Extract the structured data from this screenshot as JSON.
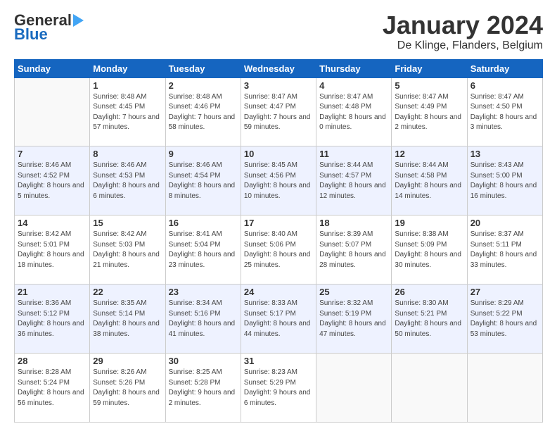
{
  "header": {
    "logo_line1": "General",
    "logo_line2": "Blue",
    "title": "January 2024",
    "subtitle": "De Klinge, Flanders, Belgium"
  },
  "days_of_week": [
    "Sunday",
    "Monday",
    "Tuesday",
    "Wednesday",
    "Thursday",
    "Friday",
    "Saturday"
  ],
  "weeks": [
    [
      {
        "day": "",
        "sunrise": "",
        "sunset": "",
        "daylight": ""
      },
      {
        "day": "1",
        "sunrise": "Sunrise: 8:48 AM",
        "sunset": "Sunset: 4:45 PM",
        "daylight": "Daylight: 7 hours and 57 minutes."
      },
      {
        "day": "2",
        "sunrise": "Sunrise: 8:48 AM",
        "sunset": "Sunset: 4:46 PM",
        "daylight": "Daylight: 7 hours and 58 minutes."
      },
      {
        "day": "3",
        "sunrise": "Sunrise: 8:47 AM",
        "sunset": "Sunset: 4:47 PM",
        "daylight": "Daylight: 7 hours and 59 minutes."
      },
      {
        "day": "4",
        "sunrise": "Sunrise: 8:47 AM",
        "sunset": "Sunset: 4:48 PM",
        "daylight": "Daylight: 8 hours and 0 minutes."
      },
      {
        "day": "5",
        "sunrise": "Sunrise: 8:47 AM",
        "sunset": "Sunset: 4:49 PM",
        "daylight": "Daylight: 8 hours and 2 minutes."
      },
      {
        "day": "6",
        "sunrise": "Sunrise: 8:47 AM",
        "sunset": "Sunset: 4:50 PM",
        "daylight": "Daylight: 8 hours and 3 minutes."
      }
    ],
    [
      {
        "day": "7",
        "sunrise": "Sunrise: 8:46 AM",
        "sunset": "Sunset: 4:52 PM",
        "daylight": "Daylight: 8 hours and 5 minutes."
      },
      {
        "day": "8",
        "sunrise": "Sunrise: 8:46 AM",
        "sunset": "Sunset: 4:53 PM",
        "daylight": "Daylight: 8 hours and 6 minutes."
      },
      {
        "day": "9",
        "sunrise": "Sunrise: 8:46 AM",
        "sunset": "Sunset: 4:54 PM",
        "daylight": "Daylight: 8 hours and 8 minutes."
      },
      {
        "day": "10",
        "sunrise": "Sunrise: 8:45 AM",
        "sunset": "Sunset: 4:56 PM",
        "daylight": "Daylight: 8 hours and 10 minutes."
      },
      {
        "day": "11",
        "sunrise": "Sunrise: 8:44 AM",
        "sunset": "Sunset: 4:57 PM",
        "daylight": "Daylight: 8 hours and 12 minutes."
      },
      {
        "day": "12",
        "sunrise": "Sunrise: 8:44 AM",
        "sunset": "Sunset: 4:58 PM",
        "daylight": "Daylight: 8 hours and 14 minutes."
      },
      {
        "day": "13",
        "sunrise": "Sunrise: 8:43 AM",
        "sunset": "Sunset: 5:00 PM",
        "daylight": "Daylight: 8 hours and 16 minutes."
      }
    ],
    [
      {
        "day": "14",
        "sunrise": "Sunrise: 8:42 AM",
        "sunset": "Sunset: 5:01 PM",
        "daylight": "Daylight: 8 hours and 18 minutes."
      },
      {
        "day": "15",
        "sunrise": "Sunrise: 8:42 AM",
        "sunset": "Sunset: 5:03 PM",
        "daylight": "Daylight: 8 hours and 21 minutes."
      },
      {
        "day": "16",
        "sunrise": "Sunrise: 8:41 AM",
        "sunset": "Sunset: 5:04 PM",
        "daylight": "Daylight: 8 hours and 23 minutes."
      },
      {
        "day": "17",
        "sunrise": "Sunrise: 8:40 AM",
        "sunset": "Sunset: 5:06 PM",
        "daylight": "Daylight: 8 hours and 25 minutes."
      },
      {
        "day": "18",
        "sunrise": "Sunrise: 8:39 AM",
        "sunset": "Sunset: 5:07 PM",
        "daylight": "Daylight: 8 hours and 28 minutes."
      },
      {
        "day": "19",
        "sunrise": "Sunrise: 8:38 AM",
        "sunset": "Sunset: 5:09 PM",
        "daylight": "Daylight: 8 hours and 30 minutes."
      },
      {
        "day": "20",
        "sunrise": "Sunrise: 8:37 AM",
        "sunset": "Sunset: 5:11 PM",
        "daylight": "Daylight: 8 hours and 33 minutes."
      }
    ],
    [
      {
        "day": "21",
        "sunrise": "Sunrise: 8:36 AM",
        "sunset": "Sunset: 5:12 PM",
        "daylight": "Daylight: 8 hours and 36 minutes."
      },
      {
        "day": "22",
        "sunrise": "Sunrise: 8:35 AM",
        "sunset": "Sunset: 5:14 PM",
        "daylight": "Daylight: 8 hours and 38 minutes."
      },
      {
        "day": "23",
        "sunrise": "Sunrise: 8:34 AM",
        "sunset": "Sunset: 5:16 PM",
        "daylight": "Daylight: 8 hours and 41 minutes."
      },
      {
        "day": "24",
        "sunrise": "Sunrise: 8:33 AM",
        "sunset": "Sunset: 5:17 PM",
        "daylight": "Daylight: 8 hours and 44 minutes."
      },
      {
        "day": "25",
        "sunrise": "Sunrise: 8:32 AM",
        "sunset": "Sunset: 5:19 PM",
        "daylight": "Daylight: 8 hours and 47 minutes."
      },
      {
        "day": "26",
        "sunrise": "Sunrise: 8:30 AM",
        "sunset": "Sunset: 5:21 PM",
        "daylight": "Daylight: 8 hours and 50 minutes."
      },
      {
        "day": "27",
        "sunrise": "Sunrise: 8:29 AM",
        "sunset": "Sunset: 5:22 PM",
        "daylight": "Daylight: 8 hours and 53 minutes."
      }
    ],
    [
      {
        "day": "28",
        "sunrise": "Sunrise: 8:28 AM",
        "sunset": "Sunset: 5:24 PM",
        "daylight": "Daylight: 8 hours and 56 minutes."
      },
      {
        "day": "29",
        "sunrise": "Sunrise: 8:26 AM",
        "sunset": "Sunset: 5:26 PM",
        "daylight": "Daylight: 8 hours and 59 minutes."
      },
      {
        "day": "30",
        "sunrise": "Sunrise: 8:25 AM",
        "sunset": "Sunset: 5:28 PM",
        "daylight": "Daylight: 9 hours and 2 minutes."
      },
      {
        "day": "31",
        "sunrise": "Sunrise: 8:23 AM",
        "sunset": "Sunset: 5:29 PM",
        "daylight": "Daylight: 9 hours and 6 minutes."
      },
      {
        "day": "",
        "sunrise": "",
        "sunset": "",
        "daylight": ""
      },
      {
        "day": "",
        "sunrise": "",
        "sunset": "",
        "daylight": ""
      },
      {
        "day": "",
        "sunrise": "",
        "sunset": "",
        "daylight": ""
      }
    ]
  ]
}
